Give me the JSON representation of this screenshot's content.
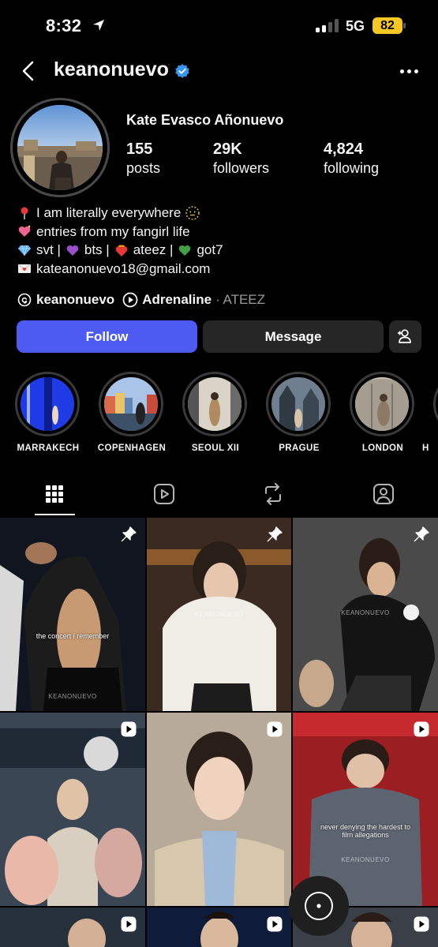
{
  "status_bar": {
    "time": "8:32",
    "network": "5G",
    "battery": "82"
  },
  "header": {
    "username": "keanonuevo"
  },
  "profile": {
    "full_name": "Kate Evasco Añonuevo",
    "stats": [
      {
        "value": "155",
        "label": "posts"
      },
      {
        "value": "29K",
        "label": "followers"
      },
      {
        "value": "4,824",
        "label": "following"
      }
    ],
    "bio": [
      "I am literally everywhere",
      "entries from my fangirl life",
      "svt |",
      "bts |",
      "ateez |",
      "got7",
      "kateanonuevo18@gmail.com"
    ],
    "threads_handle": "keanonuevo",
    "music_title": "Adrenaline",
    "music_artist": "· ATEEZ"
  },
  "buttons": {
    "follow": "Follow",
    "message": "Message"
  },
  "highlights": [
    "MARRAKECH",
    "COPENHAGEN",
    "SEOUL XII",
    "PRAGUE",
    "LONDON",
    "H"
  ],
  "posts": [
    {
      "overlay": "the concert i remember",
      "watermark": "KEANONUEVO"
    },
    {
      "overlay": "",
      "watermark": "KEANONUEVO"
    },
    {
      "overlay": "",
      "watermark": "KEANONUEVO"
    },
    {
      "overlay": "",
      "watermark": ""
    },
    {
      "overlay": "",
      "watermark": ""
    },
    {
      "overlay": "never denying the hardest to film allegations",
      "watermark": "KEANONUEVO"
    }
  ],
  "colors": {
    "follow": "#4e5bf2",
    "verified": "#3797f0",
    "battery": "#f7c823"
  },
  "icons": [
    "location-arrow-icon",
    "back-chevron-icon",
    "verified-badge-icon",
    "more-icon",
    "add-person-icon",
    "threads-icon",
    "play-circle-icon",
    "grid-icon",
    "reels-icon",
    "reposts-icon",
    "tagged-icon",
    "pin-icon",
    "reel-badge-icon",
    "camera-shutter-icon"
  ]
}
